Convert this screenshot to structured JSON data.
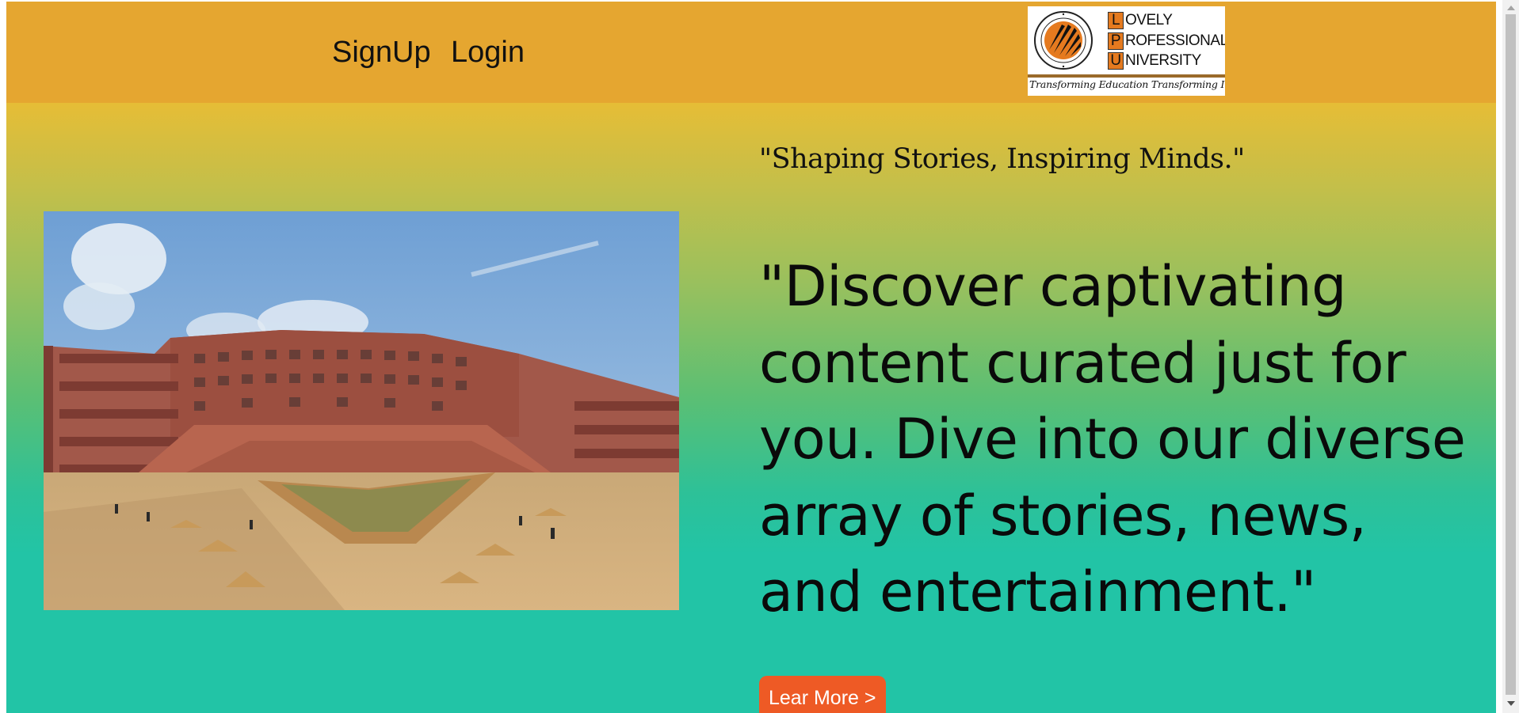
{
  "nav": {
    "signup": "SignUp",
    "login": "Login"
  },
  "logo": {
    "line1_initial": "L",
    "line1_rest": "OVELY",
    "line2_initial": "P",
    "line2_rest": "ROFESSIONAL",
    "line3_initial": "U",
    "line3_rest": "NIVERSITY",
    "tagline": "Transforming Education Transforming India",
    "seal_text": "LOVELY PROFESSIONAL UNIVERSITY · PUNJAB (INDIA)"
  },
  "hero": {
    "subtitle": "\"Shaping Stories, Inspiring Minds.\"",
    "headline": "\"Discover captivating content curated just for you. Dive into our diverse array of stories, news, and entertainment.\"",
    "button": "Lear More >",
    "image_subject": "university campus building"
  },
  "colors": {
    "navbar": "#e5a630",
    "gradient_top": "#e6bd36",
    "gradient_bottom": "#22c4a6",
    "button": "#ee5a25",
    "logo_accent": "#e57a1f"
  }
}
